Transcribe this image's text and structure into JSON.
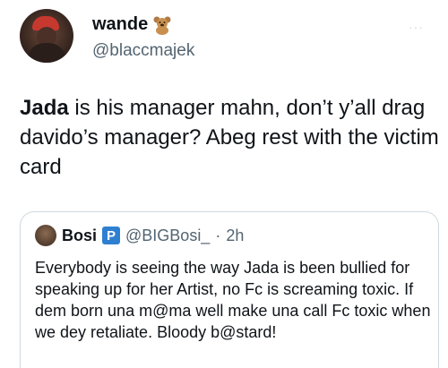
{
  "tweet": {
    "display_name": "wande",
    "handle": "@blaccmajek",
    "more_label": "···",
    "text_bold": "Jada",
    "text_rest": " is his manager mahn, don’t y’all drag davido’s manager? Abeg rest with the victim card"
  },
  "quote": {
    "display_name": "Bosi",
    "badge": "P",
    "handle": "@BIGBosi_",
    "separator": "·",
    "time": "2h",
    "text": "Everybody is seeing the way Jada is been bullied for speaking up for her Artist, no Fc is screaming toxic. If dem born una m@ma well make una  call Fc toxic when we dey retaliate. Bloody b@stard!"
  },
  "icons": {
    "name_emoji": "teddy-bear-icon",
    "more": "more-icon"
  },
  "colors": {
    "text": "#0f1419",
    "secondary": "#536471",
    "border": "#cfd9de",
    "badge": "#2f7fd1"
  }
}
